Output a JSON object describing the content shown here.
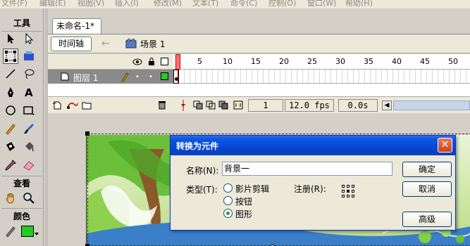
{
  "menu": {
    "items": [
      "文件(F)",
      "编辑(E)",
      "视图(V)",
      "插入(I)",
      "修改(M)",
      "文本(T)",
      "命令(C)",
      "控制(O)",
      "窗口(W)",
      "帮助(H)"
    ]
  },
  "tools": {
    "title": "工具",
    "view_title": "查看",
    "color_title": "颜色",
    "colors": {
      "fill": "#22cc22",
      "stroke": "#000000"
    }
  },
  "document": {
    "tab_title": "未命名-1*",
    "timeline_button": "时间轴",
    "scene_label": "场景 1"
  },
  "timeline": {
    "frame_numbers": [
      "1",
      "5",
      "10",
      "15",
      "20",
      "25",
      "30",
      "35",
      "40",
      "45",
      "50",
      "55",
      "60",
      "65"
    ],
    "layer_name": "图层 1",
    "current_frame": "1",
    "frame_rate": "12.0 fps",
    "elapsed_time": "0.0s"
  },
  "dialog": {
    "title": "转换为元件",
    "name_label": "名称(N):",
    "name_value": "背景一",
    "type_label": "类型(T):",
    "types": [
      {
        "label": "影片剪辑",
        "checked": false
      },
      {
        "label": "按钮",
        "checked": false
      },
      {
        "label": "图形",
        "checked": true
      }
    ],
    "registration_label": "注册(R):",
    "ok_button": "确定",
    "cancel_button": "取消",
    "advanced_button": "高级",
    "close_icon": "close-icon"
  }
}
